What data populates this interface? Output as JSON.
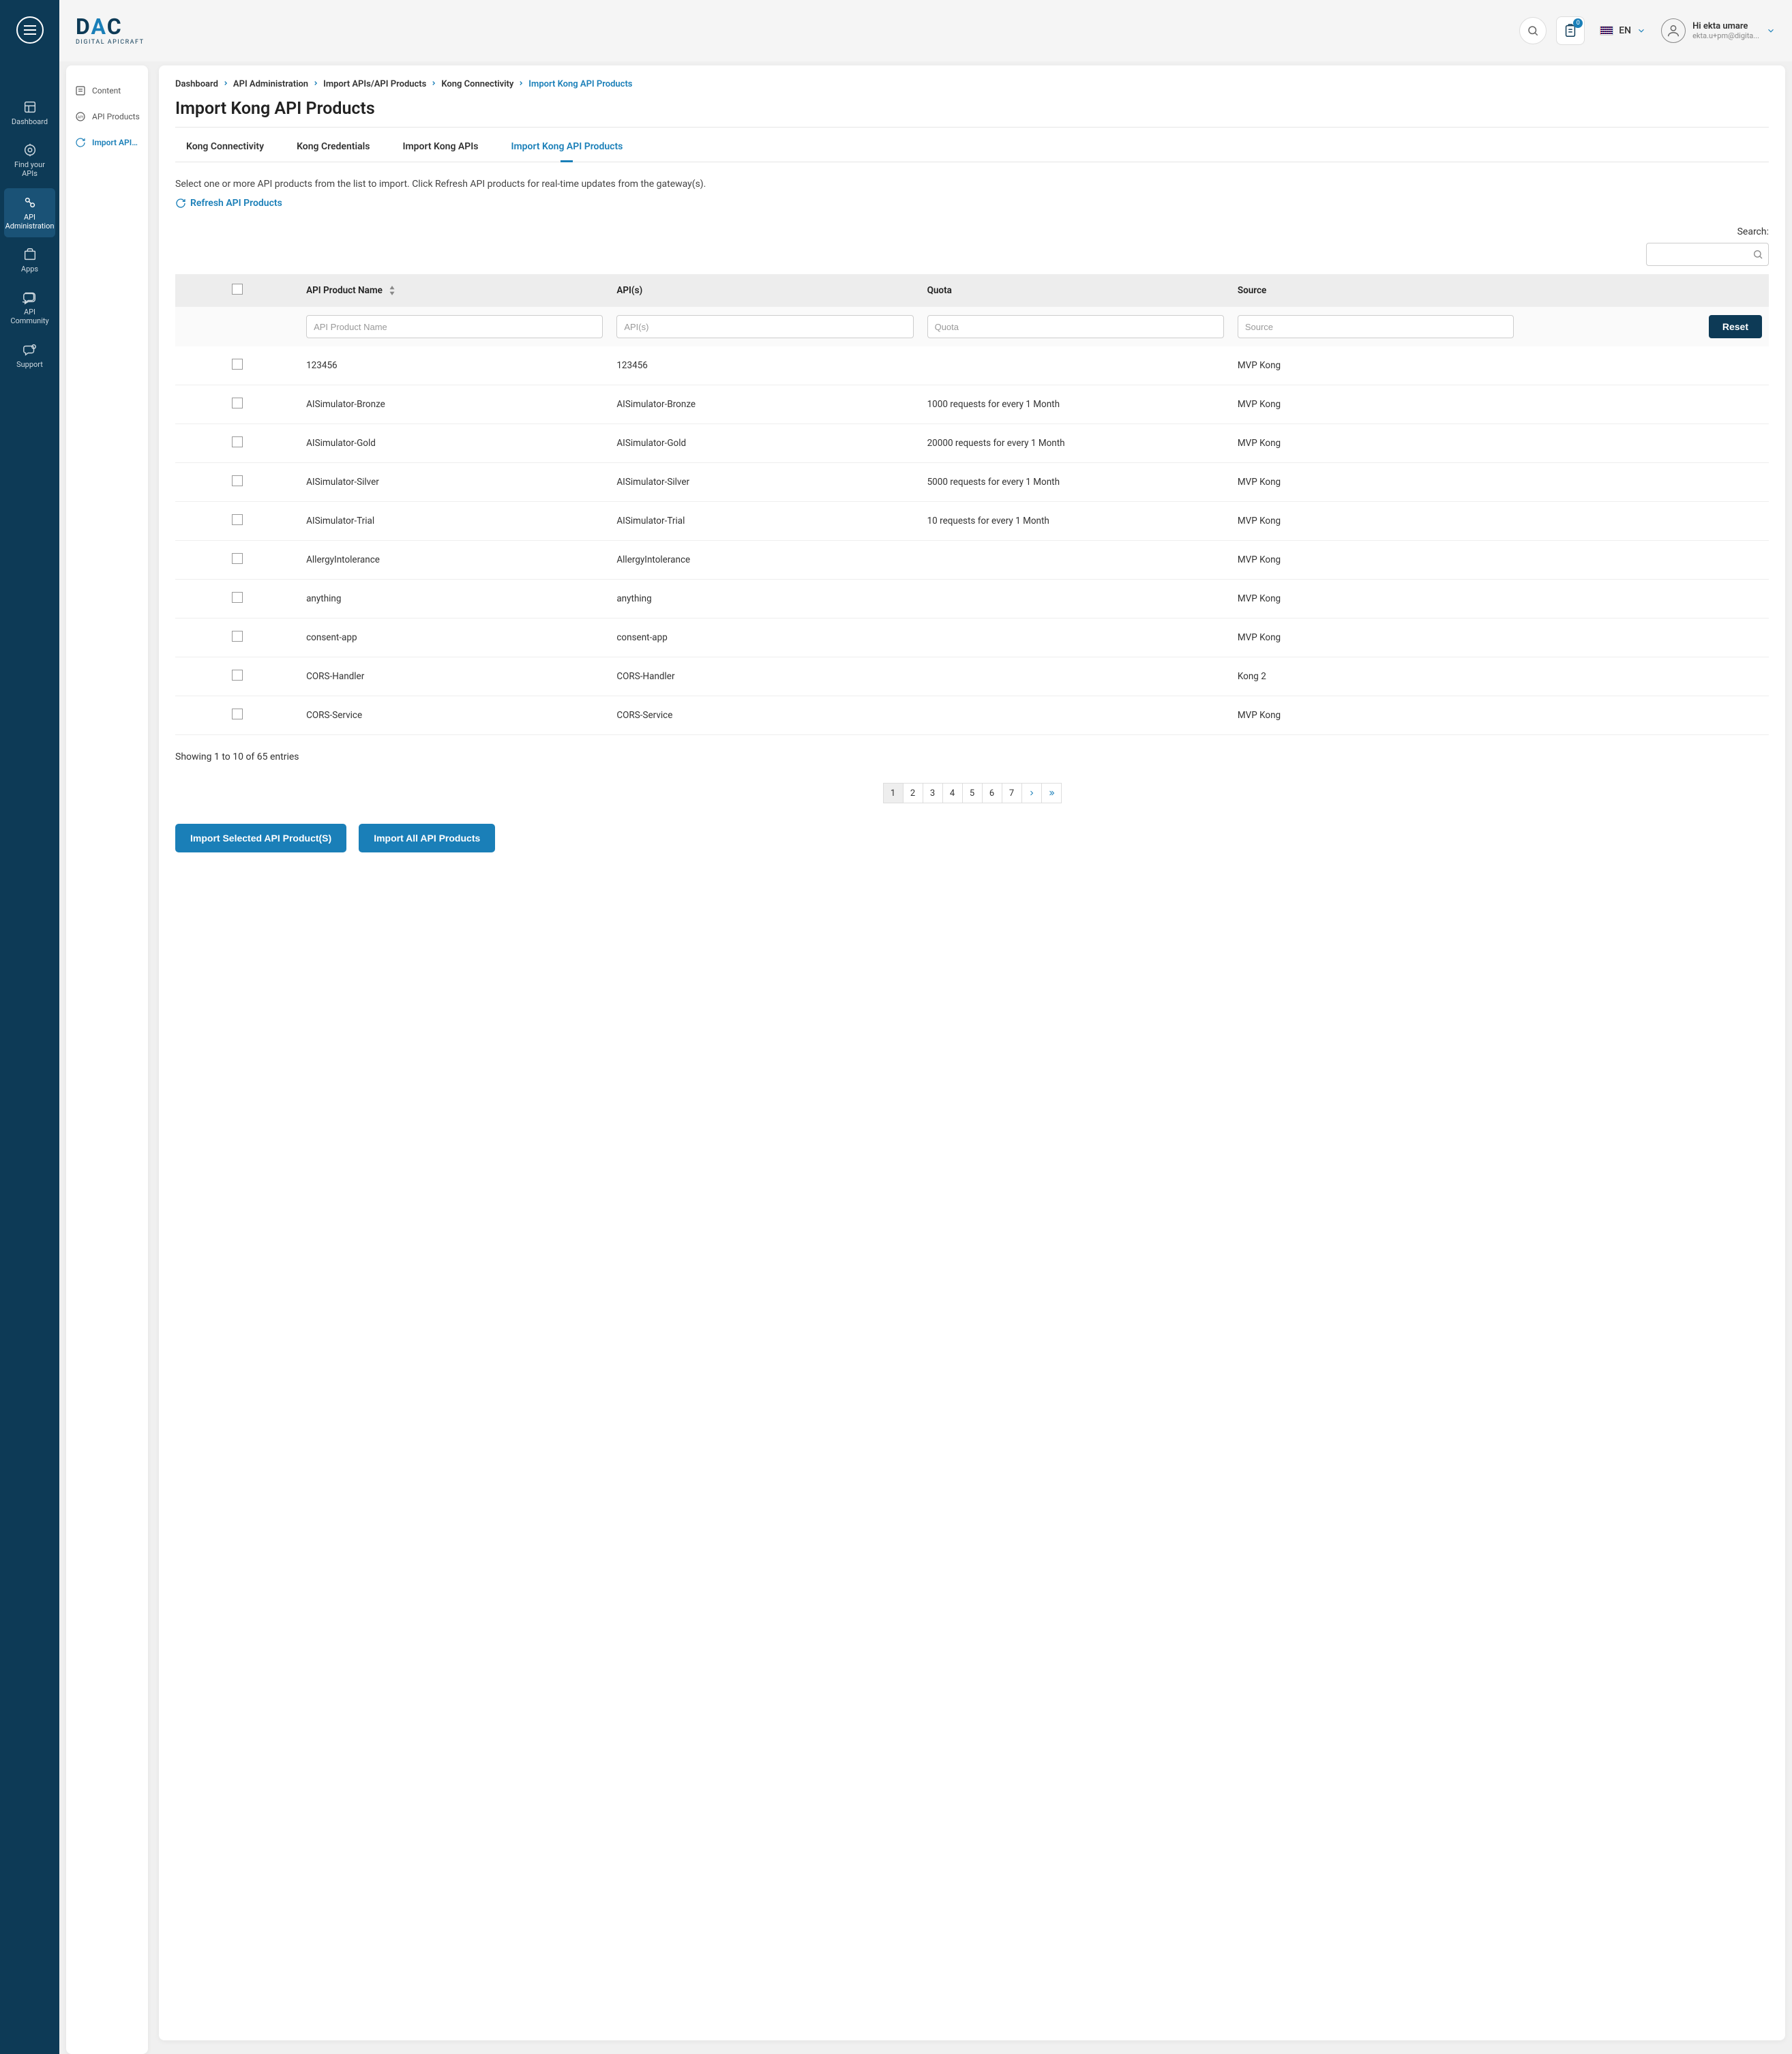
{
  "logo": {
    "text": "DAC",
    "subtitle": "DIGITAL APICRAFT"
  },
  "header": {
    "cart_count": "0",
    "lang": "EN",
    "user_greeting": "Hi ekta umare",
    "user_email": "ekta.u+pm@digita..."
  },
  "sidebar": [
    {
      "label": "Dashboard"
    },
    {
      "label": "Find your APIs"
    },
    {
      "label": "API Administration"
    },
    {
      "label": "Apps"
    },
    {
      "label": "API Community"
    },
    {
      "label": "Support"
    }
  ],
  "secondary_nav": [
    {
      "label": "Content"
    },
    {
      "label": "API Products"
    },
    {
      "label": "Import APIs / ..."
    }
  ],
  "breadcrumb": [
    "Dashboard",
    "API Administration",
    "Import APIs/API Products",
    "Kong Connectivity",
    "Import Kong API Products"
  ],
  "page_title": "Import Kong API Products",
  "tabs": [
    "Kong Connectivity",
    "Kong Credentials",
    "Import Kong APIs",
    "Import Kong API Products"
  ],
  "instructions": "Select one or more API products from the list to import. Click Refresh API products for real-time updates from the gateway(s).",
  "refresh_label": "Refresh API Products",
  "search": {
    "label": "Search:"
  },
  "columns": {
    "name": "API Product Name",
    "apis": "API(s)",
    "quota": "Quota",
    "source": "Source"
  },
  "filter_placeholders": {
    "name": "API Product Name",
    "apis": "API(s)",
    "quota": "Quota",
    "source": "Source"
  },
  "reset_label": "Reset",
  "rows": [
    {
      "name": "123456",
      "apis": "123456",
      "quota": "",
      "source": "MVP Kong"
    },
    {
      "name": "AISimulator-Bronze",
      "apis": "AISimulator-Bronze",
      "quota": "1000 requests for every 1 Month",
      "source": "MVP Kong"
    },
    {
      "name": "AISimulator-Gold",
      "apis": "AISimulator-Gold",
      "quota": "20000 requests for every 1 Month",
      "source": "MVP Kong"
    },
    {
      "name": "AISimulator-Silver",
      "apis": "AISimulator-Silver",
      "quota": "5000 requests for every 1 Month",
      "source": "MVP Kong"
    },
    {
      "name": "AISimulator-Trial",
      "apis": "AISimulator-Trial",
      "quota": "10 requests for every 1 Month",
      "source": "MVP Kong"
    },
    {
      "name": "AllergyIntolerance",
      "apis": "AllergyIntolerance",
      "quota": "",
      "source": "MVP Kong"
    },
    {
      "name": "anything",
      "apis": "anything",
      "quota": "",
      "source": "MVP Kong"
    },
    {
      "name": "consent-app",
      "apis": "consent-app",
      "quota": "",
      "source": "MVP Kong"
    },
    {
      "name": "CORS-Handler",
      "apis": "CORS-Handler",
      "quota": "",
      "source": "Kong 2"
    },
    {
      "name": "CORS-Service",
      "apis": "CORS-Service",
      "quota": "",
      "source": "MVP Kong"
    }
  ],
  "showing_text": "Showing 1 to 10 of 65 entries",
  "pages": [
    "1",
    "2",
    "3",
    "4",
    "5",
    "6",
    "7"
  ],
  "buttons": {
    "import_selected": "Import Selected API Product(S)",
    "import_all": "Import All API Products"
  }
}
